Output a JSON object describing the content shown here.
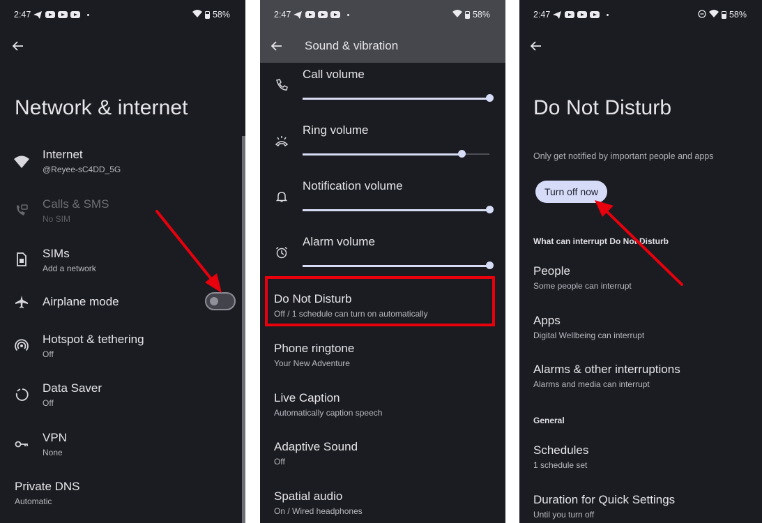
{
  "status_bar": {
    "time": "2:47",
    "battery": "58%",
    "left_icons": [
      "telegram-icon",
      "youtube-icon",
      "youtube-icon",
      "youtube-icon",
      "notification-dot"
    ],
    "right_icons_panel1": [
      "wifi-icon",
      "battery-icon"
    ],
    "right_icons_panel3": [
      "dnd-icon",
      "wifi-icon",
      "battery-icon"
    ]
  },
  "network_panel": {
    "title": "Network & internet",
    "back_icon": "back-arrow-icon",
    "items": [
      {
        "icon": "wifi-icon",
        "title": "Internet",
        "subtitle": "@Reyee-sC4DD_5G",
        "disabled": false
      },
      {
        "icon": "calls-sms-icon",
        "title": "Calls & SMS",
        "subtitle": "No SIM",
        "disabled": true
      },
      {
        "icon": "sim-icon",
        "title": "SIMs",
        "subtitle": "Add a network",
        "disabled": false
      },
      {
        "icon": "airplane-icon",
        "title": "Airplane mode",
        "subtitle": "",
        "toggle": false
      },
      {
        "icon": "hotspot-icon",
        "title": "Hotspot & tethering",
        "subtitle": "Off"
      },
      {
        "icon": "data-saver-icon",
        "title": "Data Saver",
        "subtitle": "Off"
      },
      {
        "icon": "vpn-key-icon",
        "title": "VPN",
        "subtitle": "None"
      },
      {
        "icon": "",
        "title": "Private DNS",
        "subtitle": "Automatic"
      }
    ],
    "airplane_mode_on": false
  },
  "sound_panel": {
    "title": "Sound & vibration",
    "volumes": [
      {
        "icon": "phone-icon",
        "label": "Call volume",
        "level": 1.0
      },
      {
        "icon": "ring-icon",
        "label": "Ring volume",
        "level": 0.85
      },
      {
        "icon": "bell-icon",
        "label": "Notification volume",
        "level": 1.0
      },
      {
        "icon": "alarm-icon",
        "label": "Alarm volume",
        "level": 1.0
      }
    ],
    "items": [
      {
        "title": "Do Not Disturb",
        "subtitle": "Off / 1 schedule can turn on automatically",
        "highlighted": true
      },
      {
        "title": "Phone ringtone",
        "subtitle": "Your New Adventure"
      },
      {
        "title": "Live Caption",
        "subtitle": "Automatically caption speech"
      },
      {
        "title": "Adaptive Sound",
        "subtitle": "Off"
      },
      {
        "title": "Spatial audio",
        "subtitle": "On / Wired headphones"
      }
    ]
  },
  "dnd_panel": {
    "title": "Do Not Disturb",
    "description": "Only get notified by important people and apps",
    "turn_off_button": "Turn off now",
    "section_interrupt": "What can interrupt Do Not Disturb",
    "interrupt_items": [
      {
        "title": "People",
        "subtitle": "Some people can interrupt"
      },
      {
        "title": "Apps",
        "subtitle": "Digital Wellbeing can interrupt"
      },
      {
        "title": "Alarms & other interruptions",
        "subtitle": "Alarms and media can interrupt"
      }
    ],
    "section_general": "General",
    "general_items": [
      {
        "title": "Schedules",
        "subtitle": "1 schedule set"
      },
      {
        "title": "Duration for Quick Settings",
        "subtitle": "Until you turn off"
      }
    ]
  },
  "annotations": {
    "color": "#e8000d",
    "arrows": [
      "points-to-airplane-toggle",
      "points-to-turn-off-now-button"
    ],
    "highlight_box": "do-not-disturb-item"
  },
  "colors": {
    "background": "#1b1c21",
    "app_bar": "#46474d",
    "accent": "#d6dcf8",
    "text_primary": "#e6e6ea",
    "text_secondary": "#b8b8c0"
  }
}
